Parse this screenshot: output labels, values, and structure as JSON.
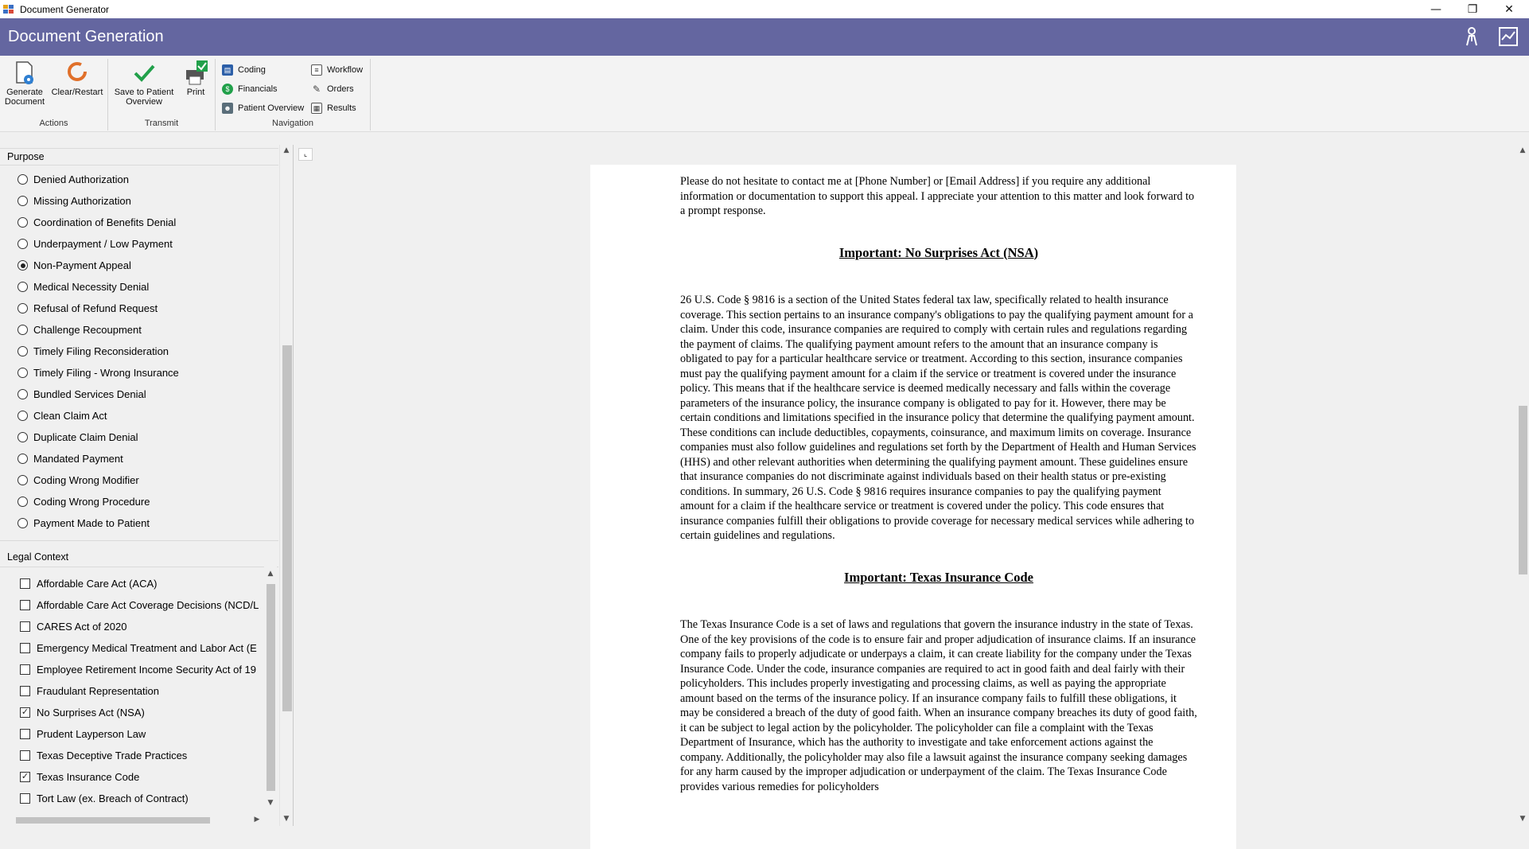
{
  "window": {
    "title": "Document Generator",
    "controls": {
      "minimize": "—",
      "restore": "❐",
      "close": "✕"
    }
  },
  "header": {
    "title": "Document Generation",
    "icons": [
      "user-badge-icon",
      "chart-icon"
    ],
    "background": "#6466a0"
  },
  "ribbon": {
    "groups": [
      {
        "label": "Actions",
        "buttons": [
          {
            "line1": "Generate",
            "line2": "Document",
            "icon": "generate-document-icon"
          },
          {
            "line1": "Clear/Restart",
            "line2": "",
            "icon": "clear-restart-icon"
          }
        ]
      },
      {
        "label": "Transmit",
        "buttons": [
          {
            "line1": "Save to Patient",
            "line2": "Overview",
            "icon": "save-check-icon"
          },
          {
            "line1": "Print",
            "line2": "",
            "icon": "print-icon"
          }
        ]
      },
      {
        "label": "Navigation",
        "items": [
          {
            "label": "Coding",
            "icon": "coding-icon"
          },
          {
            "label": "Financials",
            "icon": "financials-icon"
          },
          {
            "label": "Patient Overview",
            "icon": "patient-overview-icon"
          },
          {
            "label": "Workflow",
            "icon": "workflow-icon"
          },
          {
            "label": "Orders",
            "icon": "orders-icon"
          },
          {
            "label": "Results",
            "icon": "results-icon"
          }
        ]
      }
    ]
  },
  "purpose": {
    "title": "Purpose",
    "selected": "Non-Payment Appeal",
    "options": [
      "Denied Authorization",
      "Missing Authorization",
      "Coordination of Benefits Denial",
      "Underpayment / Low Payment",
      "Non-Payment Appeal",
      "Medical Necessity Denial",
      "Refusal of Refund Request",
      "Challenge Recoupment",
      "Timely Filing Reconsideration",
      "Timely Filing - Wrong Insurance",
      "Bundled Services Denial",
      "Clean Claim Act",
      "Duplicate Claim Denial",
      "Mandated Payment",
      "Coding Wrong Modifier",
      "Coding Wrong Procedure",
      "Payment Made to Patient"
    ]
  },
  "legal": {
    "title": "Legal Context",
    "items": [
      {
        "label": "Affordable Care Act (ACA)",
        "checked": false
      },
      {
        "label": "Affordable Care Act Coverage Decisions (NCD/L",
        "checked": false
      },
      {
        "label": "CARES Act of 2020",
        "checked": false
      },
      {
        "label": "Emergency Medical Treatment and Labor Act (E",
        "checked": false
      },
      {
        "label": "Employee Retirement Income Security Act of 19",
        "checked": false
      },
      {
        "label": "Fraudulant Representation",
        "checked": false
      },
      {
        "label": "No Surprises Act (NSA)",
        "checked": true
      },
      {
        "label": "Prudent Layperson Law",
        "checked": false
      },
      {
        "label": "Texas Deceptive Trade Practices",
        "checked": false
      },
      {
        "label": "Texas Insurance Code",
        "checked": true
      },
      {
        "label": "Tort Law (ex. Breach of Contract)",
        "checked": false
      }
    ]
  },
  "document": {
    "intro": "Please do not hesitate to contact me at [Phone Number] or [Email Address] if you require any additional information or documentation to support this appeal. I appreciate your attention to this matter and look forward to a prompt response.",
    "sections": [
      {
        "heading": "Important: No Surprises Act (NSA)",
        "body": "26 U.S. Code § 9816 is a section of the United States federal tax law, specifically related to health insurance coverage. This section pertains to an insurance company's obligations to pay the qualifying payment amount for a claim. Under this code, insurance companies are required to comply with certain rules and regulations regarding the payment of claims. The qualifying payment amount refers to the amount that an insurance company is obligated to pay for a particular healthcare service or treatment. According to this section, insurance companies must pay the qualifying payment amount for a claim if the service or treatment is covered under the insurance policy. This means that if the healthcare service is deemed medically necessary and falls within the coverage parameters of the insurance policy, the insurance company is obligated to pay for it. However, there may be certain conditions and limitations specified in the insurance policy that determine the qualifying payment amount. These conditions can include deductibles, copayments, coinsurance, and maximum limits on coverage. Insurance companies must also follow guidelines and regulations set forth by the Department of Health and Human Services (HHS) and other relevant authorities when determining the qualifying payment amount. These guidelines ensure that insurance companies do not discriminate against individuals based on their health status or pre-existing conditions. In summary, 26 U.S. Code § 9816 requires insurance companies to pay the qualifying payment amount for a claim if the healthcare service or treatment is covered under the policy. This code ensures that insurance companies fulfill their obligations to provide coverage for necessary medical services while adhering to certain guidelines and regulations."
      },
      {
        "heading": "Important: Texas Insurance Code",
        "body": "The Texas Insurance Code is a set of laws and regulations that govern the insurance industry in the state of Texas. One of the key provisions of the code is to ensure fair and proper adjudication of insurance claims. If an insurance company fails to properly adjudicate or underpays a claim, it can create liability for the company under the Texas Insurance Code. Under the code, insurance companies are required to act in good faith and deal fairly with their policyholders. This includes properly investigating and processing claims, as well as paying the appropriate amount based on the terms of the insurance policy. If an insurance company fails to fulfill these obligations, it may be considered a breach of the duty of good faith. When an insurance company breaches its duty of good faith, it can be subject to legal action by the policyholder. The policyholder can file a complaint with the Texas Department of Insurance, which has the authority to investigate and take enforcement actions against the company. Additionally, the policyholder may also file a lawsuit against the insurance company seeking damages for any harm caused by the improper adjudication or underpayment of the claim. The Texas Insurance Code provides various remedies for policyholders"
      }
    ]
  }
}
